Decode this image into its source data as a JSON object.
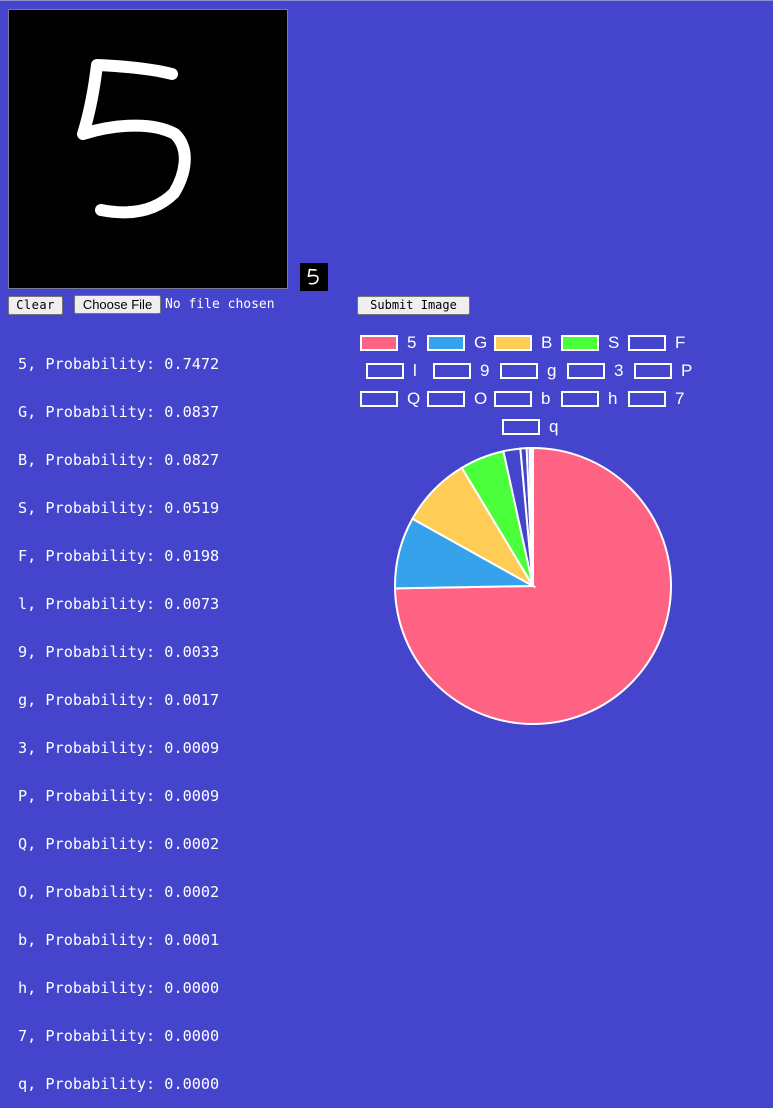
{
  "drawing": {
    "digit": "5"
  },
  "buttons": {
    "clear_label": "Clear",
    "choose_file_label": "Choose File",
    "no_file_text": "No file chosen",
    "submit_label": "Submit Image"
  },
  "results": [
    "5, Probability: 0.7472",
    "G, Probability: 0.0837",
    "B, Probability: 0.0827",
    "S, Probability: 0.0519",
    "F, Probability: 0.0198",
    "l, Probability: 0.0073",
    "9, Probability: 0.0033",
    "g, Probability: 0.0017",
    "3, Probability: 0.0009",
    "P, Probability: 0.0009",
    "Q, Probability: 0.0002",
    "O, Probability: 0.0002",
    "b, Probability: 0.0001",
    "h, Probability: 0.0000",
    "7, Probability: 0.0000",
    "q, Probability: 0.0000"
  ],
  "chart_data": {
    "type": "pie",
    "categories": [
      "5",
      "G",
      "B",
      "S",
      "F",
      "l",
      "9",
      "g",
      "3",
      "P",
      "Q",
      "O",
      "b",
      "h",
      "7",
      "q"
    ],
    "values": [
      0.7472,
      0.0837,
      0.0827,
      0.0519,
      0.0198,
      0.0073,
      0.0033,
      0.0017,
      0.0009,
      0.0009,
      0.0002,
      0.0002,
      0.0001,
      0.0,
      0.0,
      0.0
    ],
    "colors": [
      "#ff6384",
      "#36a2eb",
      "#ffcd56",
      "#4bff3b",
      "#4444cc",
      "#4444cc",
      "#4444cc",
      "#4444cc",
      "#4444cc",
      "#4444cc",
      "#4444cc",
      "#4444cc",
      "#4444cc",
      "#4444cc",
      "#4444cc",
      "#4444cc"
    ],
    "legend_position": "top"
  }
}
